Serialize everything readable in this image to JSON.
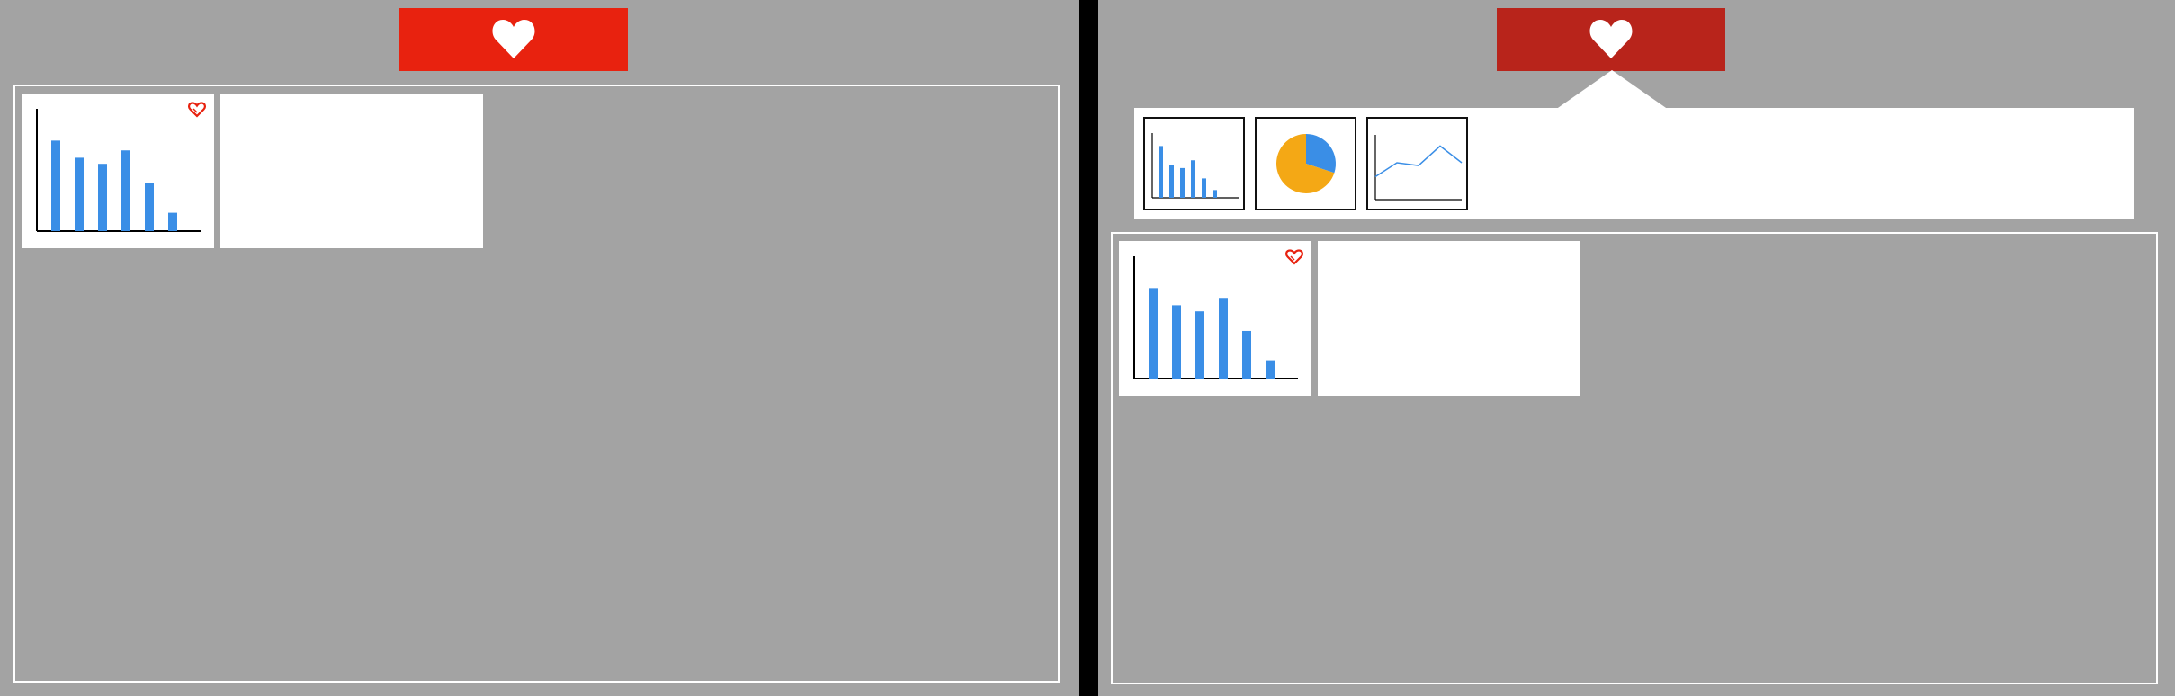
{
  "colors": {
    "panel_bg": "#a3a3a3",
    "favorite_active": "#e8220f",
    "favorite_pressed": "#b8241b",
    "bar_blue": "#3a8ee6",
    "pie_orange": "#f4a815",
    "pie_blue": "#3a8ee6",
    "line_blue": "#3a8ee6",
    "heart_outline": "#e8220f"
  },
  "icons": {
    "favorite": "heart-icon",
    "card_favorite": "heart-outline-icon"
  },
  "left_panel": {
    "favorite_button": {
      "icon": "heart-icon",
      "color": "#e8220f"
    },
    "cards": [
      {
        "type": "bar",
        "favorited": true,
        "bars": [
          0.74,
          0.6,
          0.55,
          0.66,
          0.39,
          0.15
        ]
      },
      {
        "type": "empty"
      }
    ]
  },
  "right_panel": {
    "favorite_button": {
      "icon": "heart-icon",
      "color": "#b8241b"
    },
    "chart_type_options": [
      {
        "type": "bar",
        "bars": [
          0.8,
          0.5,
          0.46,
          0.58,
          0.3,
          0.12
        ]
      },
      {
        "type": "pie",
        "slices": [
          0.3,
          0.7
        ]
      },
      {
        "type": "line",
        "points": [
          0.25,
          0.5,
          0.45,
          0.8,
          0.5
        ]
      }
    ],
    "cards": [
      {
        "type": "bar",
        "favorited": true,
        "bars": [
          0.74,
          0.6,
          0.55,
          0.66,
          0.39,
          0.15
        ]
      },
      {
        "type": "empty"
      }
    ]
  }
}
